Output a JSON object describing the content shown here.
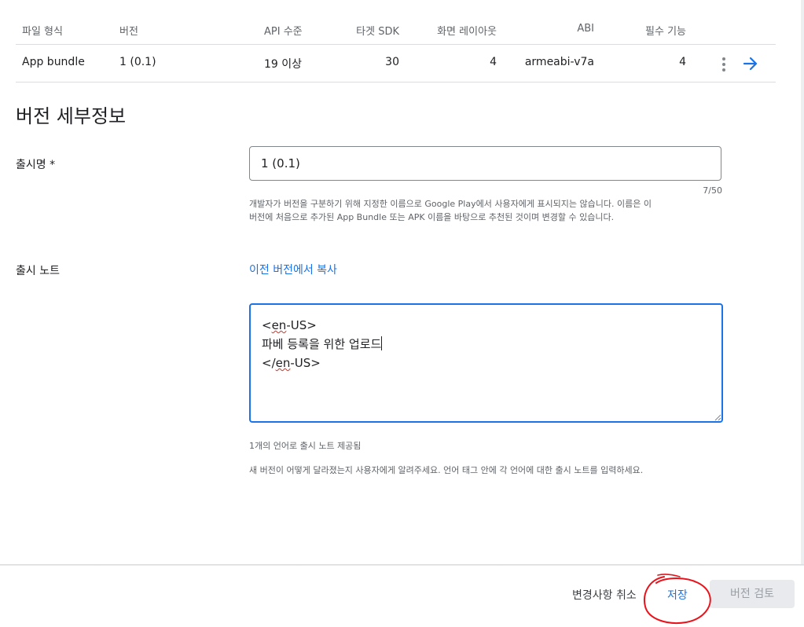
{
  "table": {
    "headers": {
      "format": "파일 형식",
      "version": "버전",
      "api": "API 수준",
      "target_sdk": "타겟 SDK",
      "screen_layout": "화면 레이아웃",
      "abi": "ABI",
      "required_features": "필수 기능"
    },
    "row": {
      "format": "App bundle",
      "version": "1 (0.1)",
      "api": "19 이상",
      "target_sdk": "30",
      "screen_layout": "4",
      "abi": "armeabi-v7a",
      "required_features": "4"
    }
  },
  "details": {
    "title": "버전 세부정보",
    "release_name_label": "출시명 *",
    "release_name_value": "1 (0.1)",
    "release_name_counter": "7/50",
    "release_name_help_line1": "개발자가 버전을 구분하기 위해 지정한 이름으로 Google Play에서 사용자에게 표시되지는 않습니다. 이름은 이",
    "release_name_help_line2": "버전에 처음으로 추가된 App Bundle 또는 APK 이름을 바탕으로 추천된 것이며 변경할 수 있습니다.",
    "release_notes_label": "출시 노트",
    "copy_link": "이전 버전에서 복사",
    "notes": {
      "line1_open": "<",
      "line1_tag": "en",
      "line1_rest": "-US>",
      "line2": "파베 등록을 위한 업로드",
      "line3_open": "</",
      "line3_tag": "en",
      "line3_rest": "-US>"
    },
    "language_count": "1개의 언어로 출시 노트 제공됨",
    "notes_help": "새 버전이 어떻게 달라졌는지 사용자에게 알려주세요. 언어 태그 안에 각 언어에 대한 출시 노트를 입력하세요."
  },
  "footer": {
    "discard_label": "변경사항 취소",
    "save_label": "저장",
    "review_label": "버전 검토"
  },
  "colors": {
    "accent": "#1a73e8",
    "annotation": "#e8131b"
  },
  "icons": [
    "more-vert-icon",
    "arrow-right-icon"
  ]
}
